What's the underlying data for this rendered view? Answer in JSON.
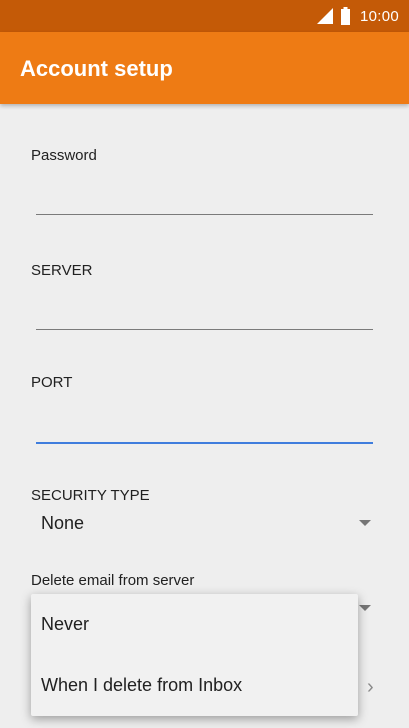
{
  "status_bar": {
    "time": "10:00",
    "icons": [
      "signal-icon",
      "battery-icon"
    ]
  },
  "app_bar": {
    "title": "Account setup",
    "color": "#ee7b14",
    "status_color": "#c45a07"
  },
  "form": {
    "password": {
      "label": "Password",
      "value": ""
    },
    "server": {
      "label": "SERVER",
      "value": ""
    },
    "port": {
      "label": "PORT",
      "value": ""
    },
    "security_type": {
      "label": "SECURITY TYPE",
      "value": "None"
    },
    "delete_email": {
      "label": "Delete email from server"
    }
  },
  "dropdown": {
    "options": [
      "Never",
      "When I delete from Inbox"
    ]
  },
  "colors": {
    "focus_underline": "#3f7ddd",
    "background": "#eeeeee"
  }
}
